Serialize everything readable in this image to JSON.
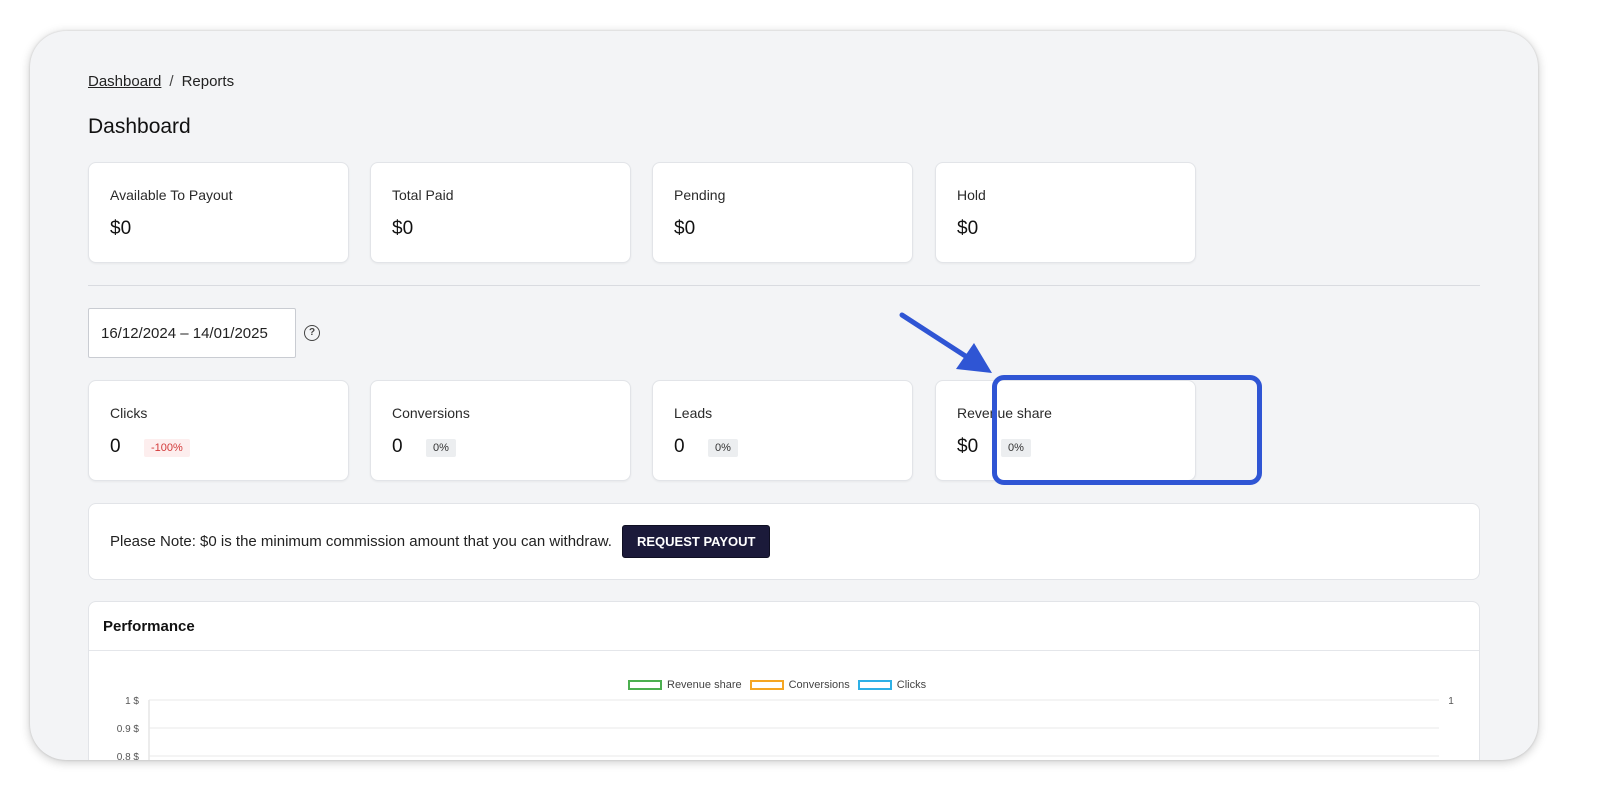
{
  "breadcrumb": {
    "home": "Dashboard",
    "separator": "/",
    "current": "Reports"
  },
  "page_title": "Dashboard",
  "balance_cards": [
    {
      "label": "Available To Payout",
      "value": "$0"
    },
    {
      "label": "Total Paid",
      "value": "$0"
    },
    {
      "label": "Pending",
      "value": "$0"
    },
    {
      "label": "Hold",
      "value": "$0"
    }
  ],
  "date_range": "16/12/2024 – 14/01/2025",
  "help_icon": "?",
  "stat_cards": [
    {
      "label": "Clicks",
      "value": "0",
      "change": "-100%"
    },
    {
      "label": "Conversions",
      "value": "0",
      "change": "0%"
    },
    {
      "label": "Leads",
      "value": "0",
      "change": "0%"
    },
    {
      "label": "Revenue share",
      "value": "$0",
      "change": "0%"
    }
  ],
  "note": {
    "text": "Please Note: $0 is the minimum commission amount that you can withdraw.",
    "button": "REQUEST PAYOUT"
  },
  "performance": {
    "title": "Performance",
    "legend": [
      {
        "label": "Revenue share",
        "color": "#4caf50"
      },
      {
        "label": "Conversions",
        "color": "#f5a623"
      },
      {
        "label": "Clicks",
        "color": "#2eb0e6"
      }
    ]
  },
  "chart_data": {
    "type": "line",
    "series": [
      {
        "name": "Revenue share",
        "values": []
      },
      {
        "name": "Conversions",
        "values": []
      },
      {
        "name": "Clicks",
        "values": []
      }
    ],
    "left_axis_ticks": [
      "1 $",
      "0.9 $",
      "0.8 $"
    ],
    "right_axis_ticks": [
      "1"
    ],
    "grid": true,
    "legend": "top-center"
  },
  "colors": {
    "highlight": "#2f55d4",
    "button_bg": "#1b1a3a",
    "negative": "#d33a3a"
  }
}
